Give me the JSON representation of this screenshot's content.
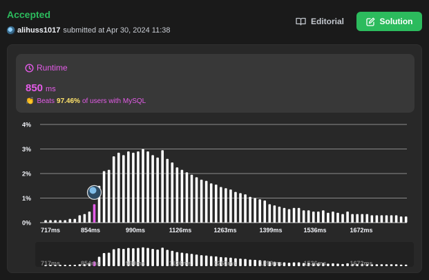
{
  "header": {
    "status": "Accepted",
    "username": "alihuss1017",
    "submitted_text": "submitted at Apr 30, 2024 11:38",
    "editorial_label": "Editorial",
    "solution_label": "Solution"
  },
  "runtime": {
    "label": "Runtime",
    "value": "850",
    "unit": "ms",
    "beats_prefix": "Beats",
    "beats_percent": "97.46%",
    "beats_suffix": "of users with MySQL"
  },
  "colors": {
    "accepted": "#2cbb5d",
    "runtime_accent": "#e45ce8",
    "beats_highlight": "#ffe36b",
    "bar": "#ffffff"
  },
  "chart_data": {
    "type": "bar",
    "y_ticks": [
      "4%",
      "3%",
      "2%",
      "1%",
      "0%"
    ],
    "ylim": [
      0,
      4
    ],
    "x_tick_labels": [
      "717ms",
      "854ms",
      "990ms",
      "1126ms",
      "1263ms",
      "1399ms",
      "1536ms",
      "1672ms"
    ],
    "values": [
      0.1,
      0.1,
      0.1,
      0.1,
      0.1,
      0.15,
      0.15,
      0.3,
      0.35,
      0.45,
      0.75,
      1.5,
      2.1,
      2.15,
      2.7,
      2.85,
      2.75,
      2.9,
      2.85,
      2.9,
      3.0,
      2.9,
      2.75,
      2.65,
      2.95,
      2.6,
      2.45,
      2.25,
      2.15,
      2.05,
      1.95,
      1.85,
      1.75,
      1.7,
      1.6,
      1.55,
      1.45,
      1.4,
      1.35,
      1.25,
      1.2,
      1.15,
      1.05,
      1.0,
      0.95,
      0.9,
      0.75,
      0.7,
      0.65,
      0.6,
      0.55,
      0.6,
      0.6,
      0.5,
      0.5,
      0.45,
      0.45,
      0.5,
      0.4,
      0.45,
      0.4,
      0.35,
      0.45,
      0.35,
      0.35,
      0.35,
      0.35,
      0.3,
      0.3,
      0.3,
      0.3,
      0.3,
      0.3,
      0.25,
      0.25
    ],
    "highlight_index": 10
  }
}
